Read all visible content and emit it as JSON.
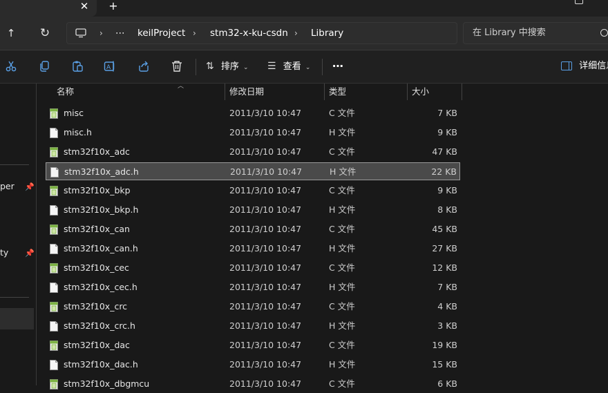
{
  "titlebar": {
    "close_glyph": "✕",
    "new_tab_glyph": "+"
  },
  "nav": {
    "up_glyph": "↑",
    "refresh_glyph": "↻"
  },
  "address": {
    "more": "⋯",
    "breadcrumb": [
      "keilProject",
      "stm32-x-ku-csdn",
      "Library"
    ]
  },
  "search": {
    "placeholder": "在 Library 中搜索"
  },
  "toolbar": {
    "sort_label": "排序",
    "view_label": "查看",
    "more_label": "⋯",
    "details_label": "详细信息"
  },
  "sidebar": {
    "items": [
      {
        "label": "per"
      },
      {
        "label": "ty"
      }
    ]
  },
  "columns": {
    "name": "名称",
    "date": "修改日期",
    "type": "类型",
    "size": "大小"
  },
  "files": [
    {
      "name": "misc",
      "date": "2011/3/10 10:47",
      "type": "C 文件",
      "size": "7 KB",
      "kind": "c"
    },
    {
      "name": "misc.h",
      "date": "2011/3/10 10:47",
      "type": "H 文件",
      "size": "9 KB",
      "kind": "h"
    },
    {
      "name": "stm32f10x_adc",
      "date": "2011/3/10 10:47",
      "type": "C 文件",
      "size": "47 KB",
      "kind": "c"
    },
    {
      "name": "stm32f10x_adc.h",
      "date": "2011/3/10 10:47",
      "type": "H 文件",
      "size": "22 KB",
      "kind": "h",
      "selected": true
    },
    {
      "name": "stm32f10x_bkp",
      "date": "2011/3/10 10:47",
      "type": "C 文件",
      "size": "9 KB",
      "kind": "c"
    },
    {
      "name": "stm32f10x_bkp.h",
      "date": "2011/3/10 10:47",
      "type": "H 文件",
      "size": "8 KB",
      "kind": "h"
    },
    {
      "name": "stm32f10x_can",
      "date": "2011/3/10 10:47",
      "type": "C 文件",
      "size": "45 KB",
      "kind": "c"
    },
    {
      "name": "stm32f10x_can.h",
      "date": "2011/3/10 10:47",
      "type": "H 文件",
      "size": "27 KB",
      "kind": "h"
    },
    {
      "name": "stm32f10x_cec",
      "date": "2011/3/10 10:47",
      "type": "C 文件",
      "size": "12 KB",
      "kind": "c"
    },
    {
      "name": "stm32f10x_cec.h",
      "date": "2011/3/10 10:47",
      "type": "H 文件",
      "size": "7 KB",
      "kind": "h"
    },
    {
      "name": "stm32f10x_crc",
      "date": "2011/3/10 10:47",
      "type": "C 文件",
      "size": "4 KB",
      "kind": "c"
    },
    {
      "name": "stm32f10x_crc.h",
      "date": "2011/3/10 10:47",
      "type": "H 文件",
      "size": "3 KB",
      "kind": "h"
    },
    {
      "name": "stm32f10x_dac",
      "date": "2011/3/10 10:47",
      "type": "C 文件",
      "size": "19 KB",
      "kind": "c"
    },
    {
      "name": "stm32f10x_dac.h",
      "date": "2011/3/10 10:47",
      "type": "H 文件",
      "size": "15 KB",
      "kind": "h"
    },
    {
      "name": "stm32f10x_dbgmcu",
      "date": "2011/3/10 10:47",
      "type": "C 文件",
      "size": "6 KB",
      "kind": "c"
    }
  ],
  "colors": {
    "background": "#191919",
    "selected_row": "#4a4a4a",
    "c_file_icon": "#7cb342"
  }
}
